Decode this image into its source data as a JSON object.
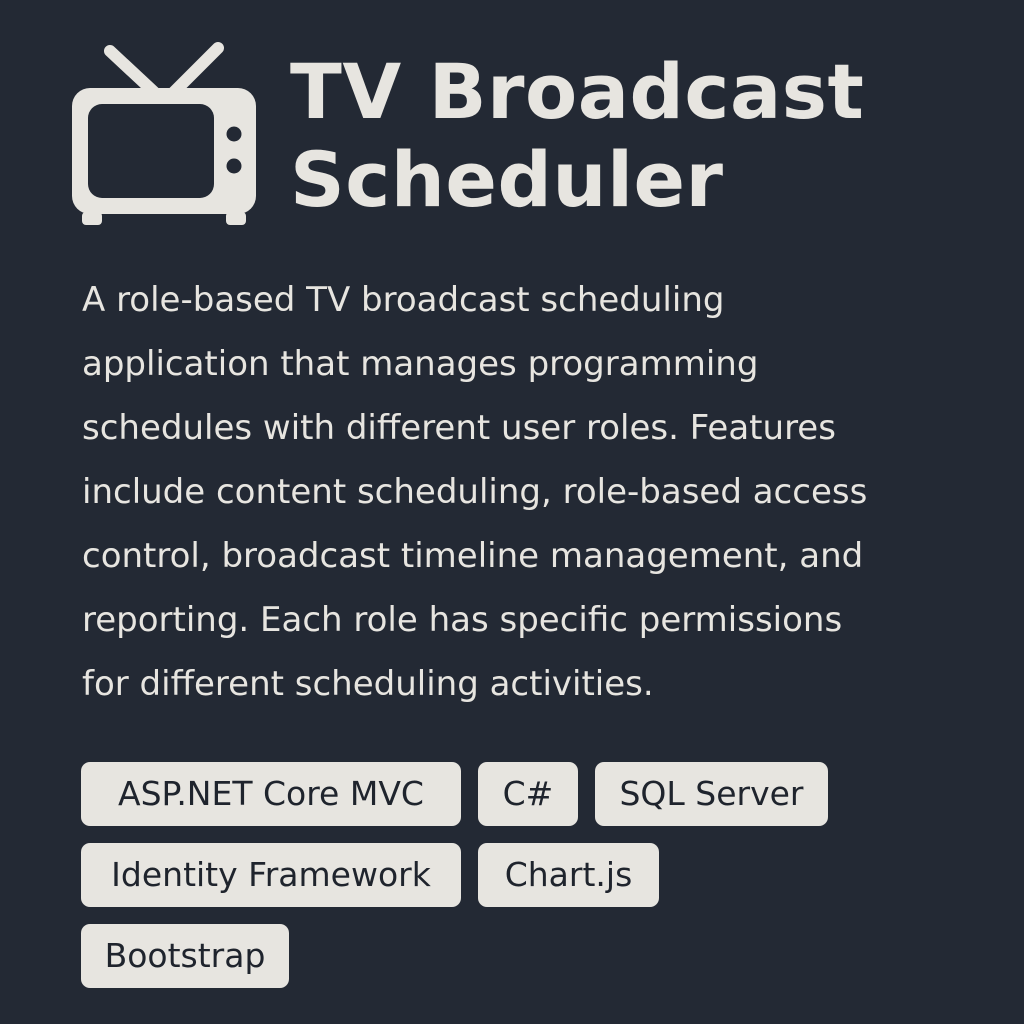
{
  "header": {
    "icon": "tv-icon",
    "title_line1": "TV Broadcast",
    "title_line2": "Scheduler"
  },
  "description": {
    "lines": [
      "A role-based TV broadcast scheduling",
      "application that manages programming",
      "schedules with different user roles. Features",
      "include content scheduling, role-based access",
      "control, broadcast timeline management, and",
      "reporting. Each role has specific permissions",
      "for different scheduling activities."
    ]
  },
  "tags": [
    "ASP.NET Core MVC",
    "C#",
    "SQL Server",
    "Identity Framework",
    "Chart.js",
    "Bootstrap"
  ],
  "colors": {
    "background": "#232934",
    "text": "#e7e5e0",
    "tag_background": "#e7e5e0",
    "tag_text": "#1f242d"
  }
}
